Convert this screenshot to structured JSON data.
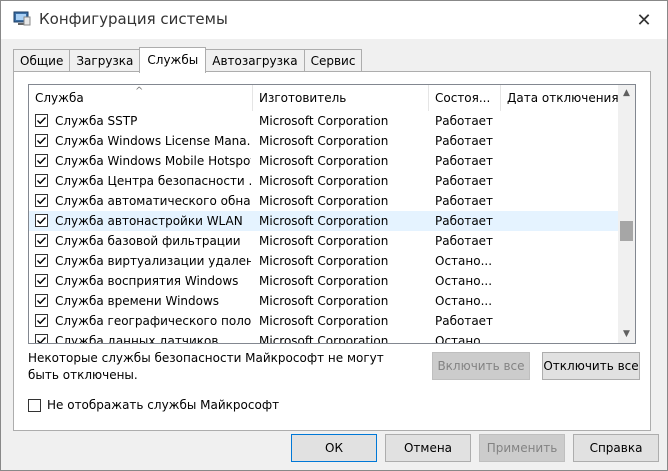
{
  "window": {
    "title": "Конфигурация системы",
    "close_glyph": "✕"
  },
  "tabs": [
    {
      "label": "Общие"
    },
    {
      "label": "Загрузка"
    },
    {
      "label": "Службы",
      "active": true
    },
    {
      "label": "Автозагрузка"
    },
    {
      "label": "Сервис"
    }
  ],
  "table": {
    "columns": [
      "Служба",
      "Изготовитель",
      "Состоя...",
      "Дата отключения"
    ],
    "sort_glyph": "^",
    "rows": [
      {
        "name": "Служба SSTP",
        "maker": "Microsoft Corporation",
        "state": "Работает",
        "checked": true
      },
      {
        "name": "Служба Windows License Mana...",
        "maker": "Microsoft Corporation",
        "state": "Работает",
        "checked": true
      },
      {
        "name": "Служба Windows Mobile Hotspot",
        "maker": "Microsoft Corporation",
        "state": "Работает",
        "checked": true
      },
      {
        "name": "Служба Центра безопасности ...",
        "maker": "Microsoft Corporation",
        "state": "Работает",
        "checked": true
      },
      {
        "name": "Служба автоматического обна...",
        "maker": "Microsoft Corporation",
        "state": "Работает",
        "checked": true
      },
      {
        "name": "Служба автонастройки WLAN",
        "maker": "Microsoft Corporation",
        "state": "Работает",
        "checked": true,
        "hover": true
      },
      {
        "name": "Служба базовой фильтрации",
        "maker": "Microsoft Corporation",
        "state": "Работает",
        "checked": true
      },
      {
        "name": "Служба виртуализации удален...",
        "maker": "Microsoft Corporation",
        "state": "Остано...",
        "checked": true
      },
      {
        "name": "Служба восприятия Windows",
        "maker": "Microsoft Corporation",
        "state": "Остано...",
        "checked": true
      },
      {
        "name": "Служба времени Windows",
        "maker": "Microsoft Corporation",
        "state": "Остано...",
        "checked": true
      },
      {
        "name": "Служба географического поло...",
        "maker": "Microsoft Corporation",
        "state": "Работает",
        "checked": true
      },
      {
        "name": "Служба данных датчиков",
        "maker": "Microsoft Corporation",
        "state": "Остано...",
        "checked": true
      }
    ]
  },
  "scrollbar": {
    "up_glyph": "▲",
    "down_glyph": "▼"
  },
  "note": "Некоторые службы безопасности Майкрософт не могут быть отключены.",
  "buttons": {
    "enable_all": "Включить все",
    "disable_all": "Отключить все",
    "ok": "ОК",
    "cancel": "Отмена",
    "apply": "Применить",
    "help": "Справка"
  },
  "hide_ms": {
    "label": "Не отображать службы Майкрософт",
    "checked": false
  }
}
